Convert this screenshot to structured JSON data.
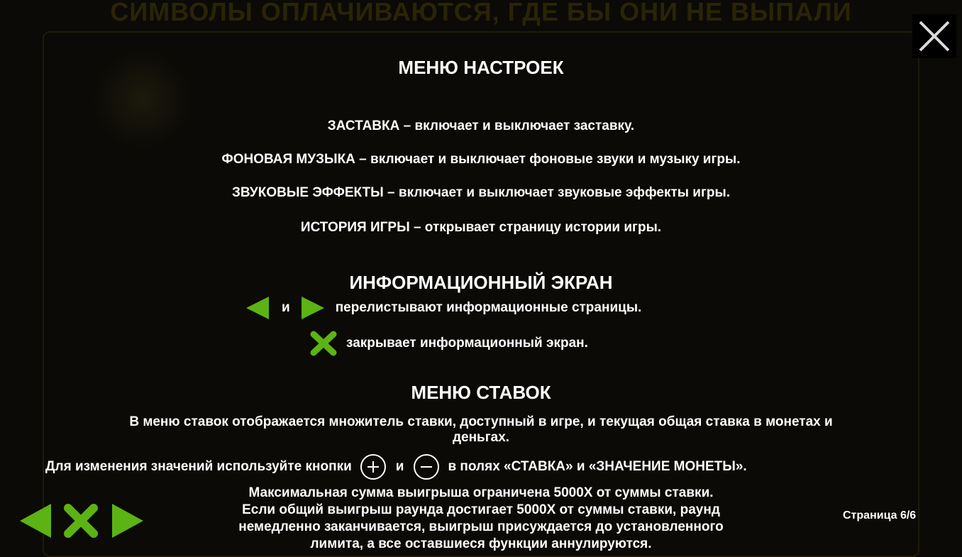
{
  "background": {
    "title": "СИМВОЛЫ ОПЛАЧИВАЮТСЯ, ГДЕ БЫ ОНИ НЕ ВЫПАЛИ"
  },
  "colors": {
    "accent_green": "#5cb314",
    "text": "#ffffff",
    "overlay": "#0b0a06"
  },
  "icons": {
    "close": "close-icon",
    "prev": "arrow-left-icon",
    "next": "arrow-right-icon",
    "close_green": "close-x-icon",
    "plus": "plus-circle-icon",
    "minus": "minus-circle-icon"
  },
  "settings_menu": {
    "title": "МЕНЮ НАСТРОЕК",
    "lines": [
      "ЗАСТАВКА – включает и выключает заставку.",
      "ФОНОВАЯ МУЗЫКА – включает и выключает фоновые звуки и музыку игры.",
      "ЗВУКОВЫЕ ЭФФЕКТЫ – включает и выключает звуковые эффекты игры.",
      "ИСТОРИЯ ИГРЫ – открывает страницу истории игры."
    ]
  },
  "info_screen": {
    "title": "ИНФОРМАЦИОННЫЙ ЭКРАН",
    "and_word": "и",
    "arrows_text": "перелистывают информационные страницы.",
    "close_text": "закрывает информационный экран."
  },
  "bet_menu": {
    "title": "МЕНЮ СТАВОК",
    "line1": "В меню ставок отображается множитель ставки, доступный в игре, и текущая общая ставка в монетах и",
    "line1b": "деньгах.",
    "line2_pre": "Для изменения значений используйте кнопки",
    "line2_and": "и",
    "line2_post": "в полях «СТАВКА» и «ЗНАЧЕНИЕ МОНЕТЫ».",
    "max_win": [
      "Максимальная сумма выигрыша ограничена 5000Х от суммы ставки.",
      "Если общий выигрыш раунда достигает 5000Х от суммы ставки, раунд",
      "немедленно заканчивается, выигрыш присуждается до установленного",
      "лимита, а все оставшиеся функции аннулируются."
    ]
  },
  "footer": {
    "page_indicator": "Страница 6/6"
  }
}
